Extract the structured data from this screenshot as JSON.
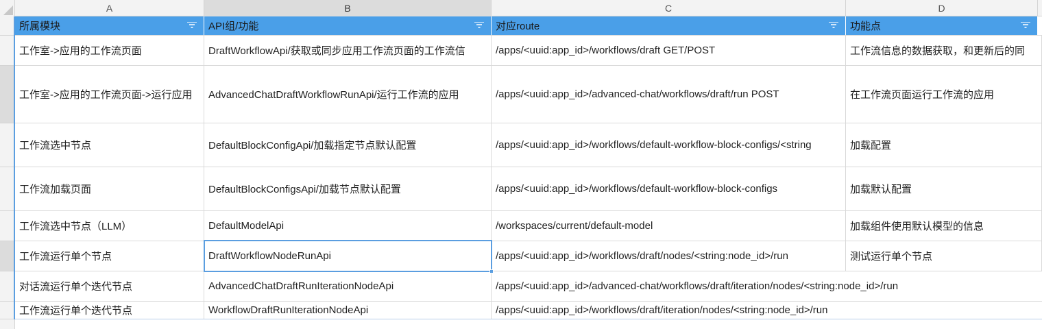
{
  "columns": [
    {
      "letter": "A"
    },
    {
      "letter": "B"
    },
    {
      "letter": "C"
    },
    {
      "letter": "D"
    }
  ],
  "header": {
    "cells": [
      "所属模块",
      "API组/功能",
      "对应route",
      "功能点"
    ]
  },
  "rows": [
    [
      "工作室->应用的工作流页面",
      "DraftWorkflowApi/获取或同步应用工作流页面的工作流信",
      "/apps/<uuid:app_id>/workflows/draft GET/POST",
      "工作流信息的数据获取，和更新后的同"
    ],
    [
      "工作室->应用的工作流页面->运行应用",
      "AdvancedChatDraftWorkflowRunApi/运行工作流的应用",
      "/apps/<uuid:app_id>/advanced-chat/workflows/draft/run POST",
      "在工作流页面运行工作流的应用"
    ],
    [
      "工作流选中节点",
      "DefaultBlockConfigApi/加载指定节点默认配置",
      "/apps/<uuid:app_id>/workflows/default-workflow-block-configs/<string",
      "加载配置"
    ],
    [
      "工作流加载页面",
      "DefaultBlockConfigsApi/加载节点默认配置",
      "/apps/<uuid:app_id>/workflows/default-workflow-block-configs",
      "加载默认配置"
    ],
    [
      "工作流选中节点（LLM）",
      "DefaultModelApi",
      "/workspaces/current/default-model",
      "加载组件使用默认模型的信息"
    ],
    [
      "工作流运行单个节点",
      "DraftWorkflowNodeRunApi",
      "/apps/<uuid:app_id>/workflows/draft/nodes/<string:node_id>/run",
      "测试运行单个节点"
    ],
    [
      "对话流运行单个迭代节点",
      "AdvancedChatDraftRunIterationNodeApi",
      "/apps/<uuid:app_id>/advanced-chat/workflows/draft/iteration/nodes/<string:node_id>/run",
      ""
    ],
    [
      "工作流运行单个迭代节点",
      "WorkflowDraftRunIterationNodeApi",
      "/apps/<uuid:app_id>/workflows/draft/iteration/nodes/<string:node_id>/run",
      ""
    ]
  ],
  "icons": {
    "filter": "filter-icon"
  },
  "colors": {
    "header_fill": "#4a9fe8",
    "selection_border": "#5b9ee0"
  }
}
